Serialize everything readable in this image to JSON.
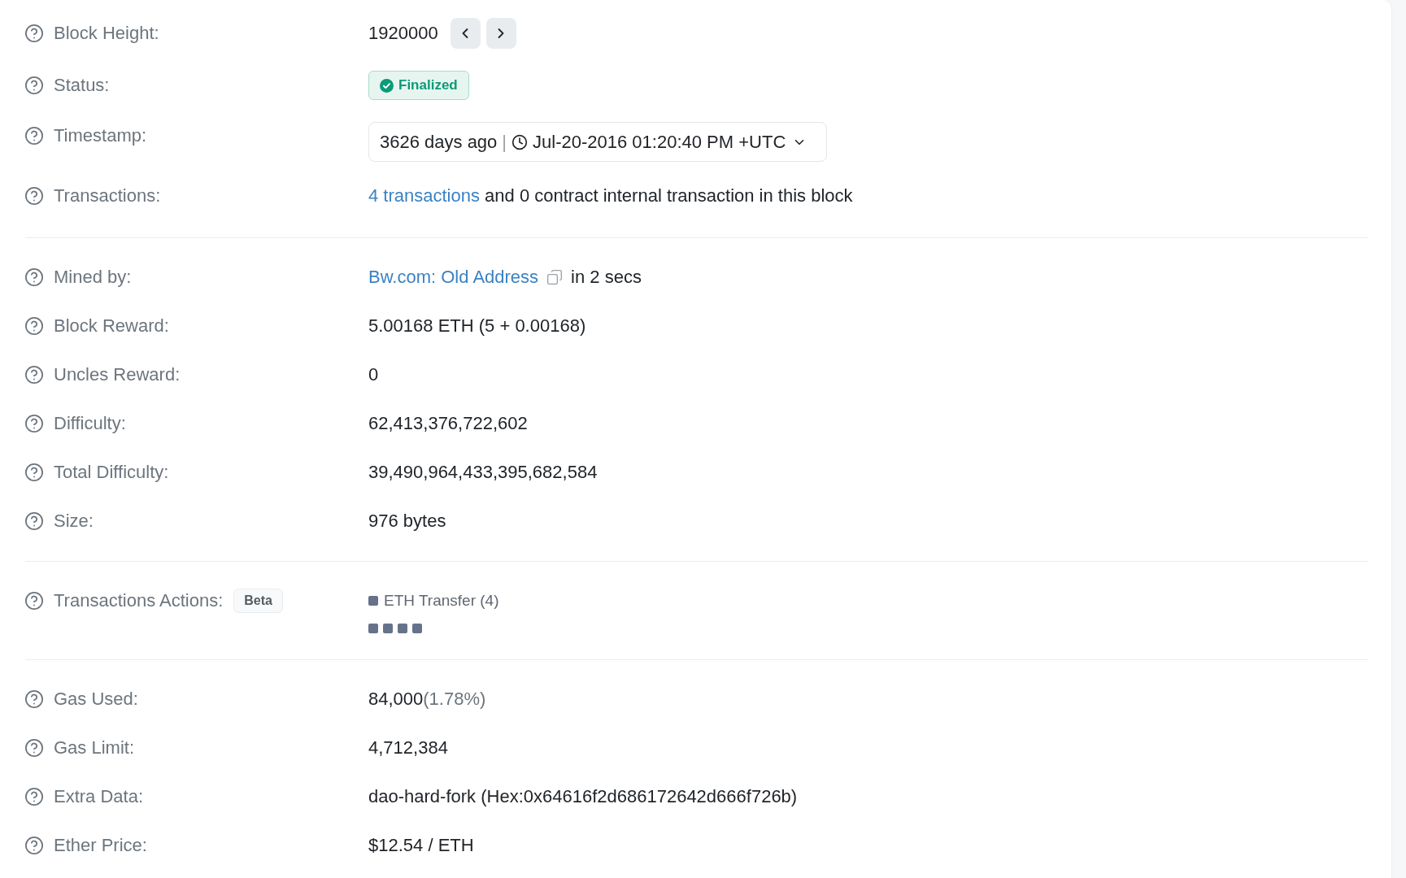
{
  "sections": [
    {
      "rows": [
        {
          "kind": "block_height",
          "label": "Block Height:",
          "value": "1920000"
        },
        {
          "kind": "status",
          "label": "Status:",
          "badge": "Finalized"
        },
        {
          "kind": "timestamp",
          "label": "Timestamp:",
          "age": "3626 days ago",
          "separator": "|",
          "datetime": "Jul-20-2016 01:20:40 PM +UTC"
        },
        {
          "kind": "transactions",
          "label": "Transactions:",
          "link": "4 transactions",
          "text": "and 0 contract internal transaction in this block"
        }
      ]
    },
    {
      "rows": [
        {
          "kind": "mined_by",
          "label": "Mined by:",
          "link": "Bw.com: Old Address",
          "text": "in 2 secs"
        },
        {
          "kind": "text",
          "label": "Block Reward:",
          "value": "5.00168 ETH (5 + 0.00168)"
        },
        {
          "kind": "text",
          "label": "Uncles Reward:",
          "value": "0"
        },
        {
          "kind": "text",
          "label": "Difficulty:",
          "value": "62,413,376,722,602"
        },
        {
          "kind": "text",
          "label": "Total Difficulty:",
          "value": "39,490,964,433,395,682,584"
        },
        {
          "kind": "text",
          "label": "Size:",
          "value": "976 bytes"
        }
      ]
    },
    {
      "rows": [
        {
          "kind": "actions",
          "label": "Transactions Actions:",
          "badge": "Beta",
          "legend": {
            "label": "ETH Transfer (4)",
            "color": "#66728a"
          },
          "squares": [
            {
              "color": "#66728a"
            },
            {
              "color": "#66728a"
            },
            {
              "color": "#66728a"
            },
            {
              "color": "#66728a"
            }
          ]
        }
      ]
    },
    {
      "rows": [
        {
          "kind": "gas_used",
          "label": "Gas Used:",
          "value": "84,000",
          "percent": "(1.78%)"
        },
        {
          "kind": "text",
          "label": "Gas Limit:",
          "value": "4,712,384"
        },
        {
          "kind": "text",
          "label": "Extra Data:",
          "value": "dao-hard-fork (Hex:0x64616f2d686172642d666f726b)"
        },
        {
          "kind": "text",
          "label": "Ether Price:",
          "value": "$12.54 / ETH"
        }
      ]
    }
  ]
}
